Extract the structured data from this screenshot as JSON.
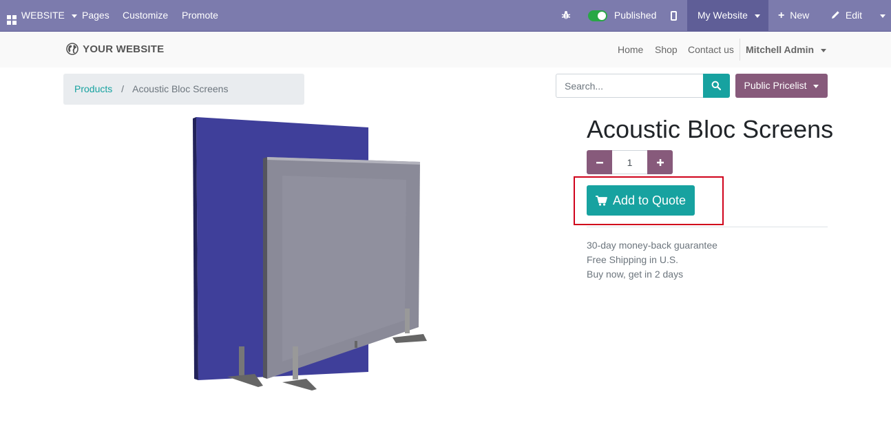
{
  "adminbar": {
    "website_menu": "WEBSITE",
    "pages": "Pages",
    "customize": "Customize",
    "promote": "Promote",
    "published": "Published",
    "my_website": "My Website",
    "new": "New",
    "edit": "Edit",
    "icons": [
      "apps-icon",
      "bug-icon",
      "toggle-icon",
      "mobile-icon",
      "plus-icon",
      "pencil-icon"
    ]
  },
  "header": {
    "logo_text": "YOUR WEBSITE",
    "nav": [
      "Home",
      "Shop",
      "Contact us"
    ],
    "user": "Mitchell Admin"
  },
  "breadcrumb": {
    "parent": "Products",
    "separator": "/",
    "current": "Acoustic Bloc Screens"
  },
  "search": {
    "placeholder": "Search..."
  },
  "pricelist": "Public Pricelist",
  "product": {
    "name": "Acoustic Bloc Screens",
    "quantity": "1",
    "add_button": "Add to Quote",
    "terms": [
      "30-day money-back guarantee",
      "Free Shipping in U.S.",
      "Buy now, get in 2 days"
    ]
  },
  "colors": {
    "adminbar": "#7c7bad",
    "primary": "#17a2a0",
    "secondary": "#875a7b",
    "highlight": "#d0021b"
  }
}
